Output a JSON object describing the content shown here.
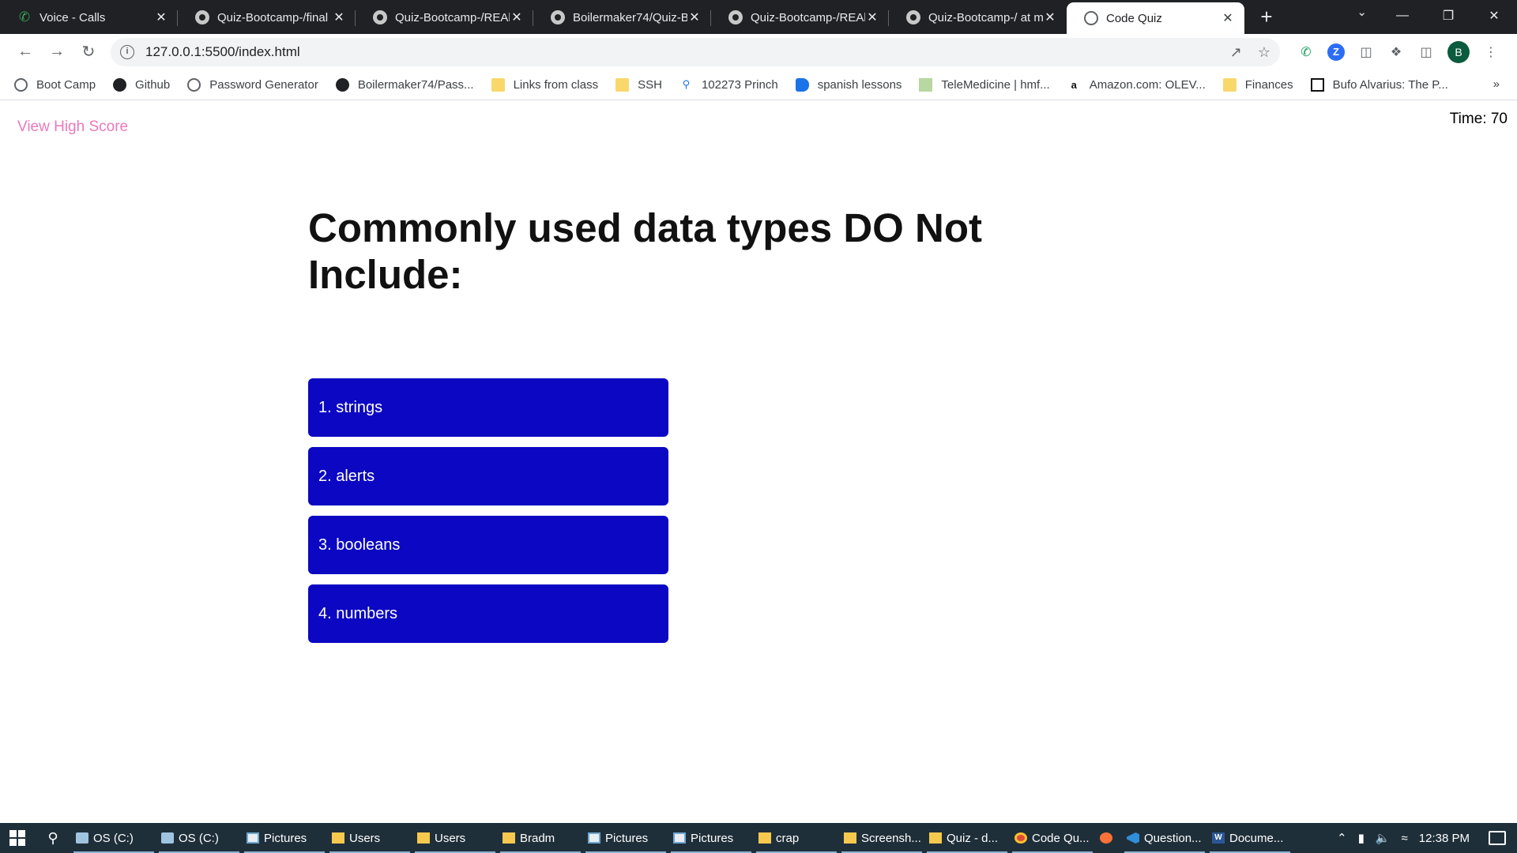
{
  "browser": {
    "tabs": [
      {
        "title": "Voice - Calls",
        "icon": "phone-icon",
        "active": false
      },
      {
        "title": "Quiz-Bootcamp-/final",
        "icon": "github-icon",
        "active": false
      },
      {
        "title": "Quiz-Bootcamp-/REAl",
        "icon": "github-icon",
        "active": false
      },
      {
        "title": "Boilermaker74/Quiz-B",
        "icon": "github-icon",
        "active": false
      },
      {
        "title": "Quiz-Bootcamp-/REAl",
        "icon": "github-icon",
        "active": false
      },
      {
        "title": "Quiz-Bootcamp-/ at m",
        "icon": "github-icon",
        "active": false
      },
      {
        "title": "Code Quiz",
        "icon": "globe-icon",
        "active": true
      }
    ],
    "url": "127.0.0.1:5500/index.html",
    "bookmarks": [
      {
        "label": "Boot Camp",
        "icon": "globe-icon"
      },
      {
        "label": "Github",
        "icon": "github-icon"
      },
      {
        "label": "Password Generator",
        "icon": "globe-icon"
      },
      {
        "label": "Boilermaker74/Pass...",
        "icon": "github-icon"
      },
      {
        "label": "Links from class",
        "icon": "folder-icon"
      },
      {
        "label": "SSH",
        "icon": "folder-icon"
      },
      {
        "label": "102273 Princh",
        "icon": "map-pin-icon"
      },
      {
        "label": "spanish lessons",
        "icon": "bookmark-app-icon"
      },
      {
        "label": "TeleMedicine | hmf...",
        "icon": "telemedicine-icon"
      },
      {
        "label": "Amazon.com: OLEV...",
        "icon": "amazon-icon"
      },
      {
        "label": "Finances",
        "icon": "folder-icon"
      },
      {
        "label": "Bufo Alvarius: The P...",
        "icon": "museum-icon"
      }
    ],
    "profile_initial": "B",
    "extension_z": "Z"
  },
  "quiz": {
    "high_score_link": "View High Score",
    "timer_text": "Time: 70",
    "question": "Commonly used data types DO Not Include:",
    "answers": [
      "1. strings",
      "2. alerts",
      "3. booleans",
      "4. numbers"
    ],
    "colors": {
      "link": "#ea79bd",
      "answer_bg": "#0c07c2",
      "answer_text": "#ffffff"
    }
  },
  "taskbar": {
    "items": [
      {
        "label": "OS (C:)",
        "icon": "drive-icon"
      },
      {
        "label": "OS (C:)",
        "icon": "drive-icon"
      },
      {
        "label": "Pictures",
        "icon": "pictures-icon"
      },
      {
        "label": "Users",
        "icon": "folder-icon"
      },
      {
        "label": "Users",
        "icon": "folder-icon"
      },
      {
        "label": "Bradm",
        "icon": "folder-icon"
      },
      {
        "label": "Pictures",
        "icon": "pictures-icon"
      },
      {
        "label": "Pictures",
        "icon": "pictures-icon"
      },
      {
        "label": "crap",
        "icon": "folder-icon"
      },
      {
        "label": "Screensh...",
        "icon": "folder-icon"
      },
      {
        "label": "Quiz - d...",
        "icon": "folder-icon"
      },
      {
        "label": "Code Qu...",
        "icon": "chrome-icon"
      },
      {
        "label": "",
        "icon": "firefox-icon"
      },
      {
        "label": "Question...",
        "icon": "vscode-icon"
      },
      {
        "label": "Docume...",
        "icon": "word-icon"
      }
    ],
    "clock": "12:38 PM"
  }
}
